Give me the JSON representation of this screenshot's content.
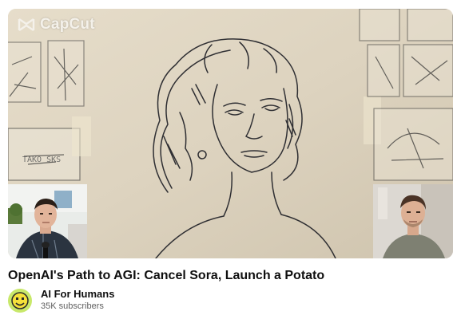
{
  "video": {
    "overlay_brand": "CapCut",
    "storyboard_text": "TAKO SKS",
    "title": "OpenAI's Path to AGI: Cancel Sora, Launch a Potato"
  },
  "channel": {
    "name": "AI For Humans",
    "subscribers": "35K subscribers",
    "avatar_icon": "pixel-smiley-avatar-icon"
  },
  "colors": {
    "paper": "#ddd3bf",
    "sketch_line": "#2f2f33",
    "avatar_bg": "#c8e86a",
    "avatar_face": "#f5e13a",
    "text_primary": "#0f0f0f",
    "text_secondary": "#606060"
  }
}
